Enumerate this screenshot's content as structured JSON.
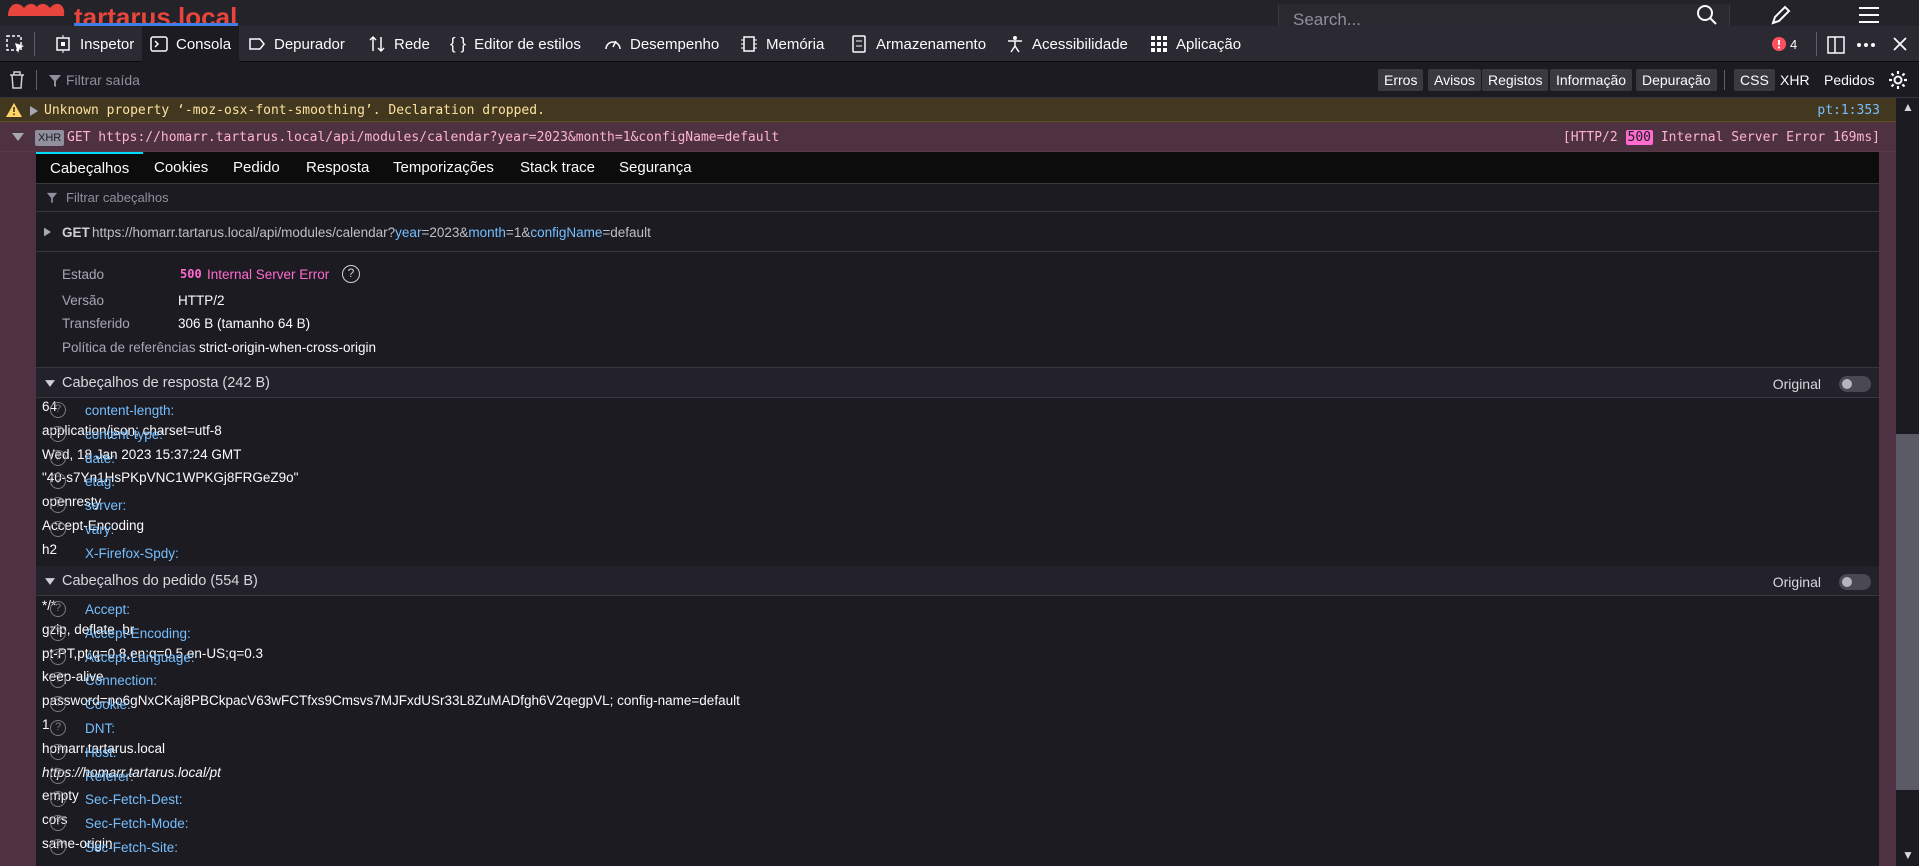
{
  "page": {
    "brand": "tartarus.local",
    "search_placeholder": "Search..."
  },
  "toolbar": {
    "tabs": [
      {
        "label": "Inspetor"
      },
      {
        "label": "Consola"
      },
      {
        "label": "Depurador"
      },
      {
        "label": "Rede"
      },
      {
        "label": "Editor de estilos"
      },
      {
        "label": "Desempenho"
      },
      {
        "label": "Memória"
      },
      {
        "label": "Armazenamento"
      },
      {
        "label": "Acessibilidade"
      },
      {
        "label": "Aplicação"
      }
    ],
    "error_count": "4"
  },
  "filterbar": {
    "placeholder": "Filtrar saída",
    "levels": [
      "Erros",
      "Avisos",
      "Registos",
      "Informação",
      "Depuração"
    ],
    "extras": [
      "CSS",
      "XHR",
      "Pedidos"
    ]
  },
  "warning": {
    "message": "Unknown property ‘-moz-osx-font-smoothing’.  Declaration dropped.",
    "location": "pt:1:353"
  },
  "request": {
    "badge": "XHR",
    "line": "GET https://homarr.tartarus.local/api/modules/calendar?year=2023&month=1&configName=default",
    "status_prefix": "[HTTP/2 ",
    "status_code": "500",
    "status_suffix": " Internal Server Error 169ms]"
  },
  "details": {
    "tabs": [
      "Cabeçalhos",
      "Cookies",
      "Pedido",
      "Resposta",
      "Temporizações",
      "Stack trace",
      "Segurança"
    ],
    "filter_placeholder": "Filtrar cabeçalhos",
    "method": "GET",
    "url_base": "https://homarr.tartarus.local/api/modules/calendar",
    "url_params": [
      {
        "key": "year",
        "value": "2023"
      },
      {
        "key": "month",
        "value": "1"
      },
      {
        "key": "configName",
        "value": "default"
      }
    ],
    "summary": {
      "estado_label": "Estado",
      "estado_code": "500",
      "estado_text": "Internal Server Error",
      "versao_label": "Versão",
      "versao": "HTTP/2",
      "transferido_label": "Transferido",
      "transferido": "306 B (tamanho 64 B)",
      "politica_label": "Política de referências",
      "politica": "strict-origin-when-cross-origin"
    },
    "response_headers_title": "Cabeçalhos de resposta (242 B)",
    "request_headers_title": "Cabeçalhos do pedido (554 B)",
    "original_label": "Original",
    "response_headers": [
      {
        "name": "content-length:",
        "value": "64",
        "help": true
      },
      {
        "name": "content-type:",
        "value": "application/json; charset=utf-8",
        "help": true
      },
      {
        "name": "date:",
        "value": "Wed, 18 Jan 2023 15:37:24 GMT",
        "help": true
      },
      {
        "name": "etag:",
        "value": "\"40-s7Yn1HsPKpVNC1WPKGj8FRGeZ9o\"",
        "help": true
      },
      {
        "name": "server:",
        "value": "openresty",
        "help": true
      },
      {
        "name": "vary:",
        "value": "Accept-Encoding",
        "help": true
      },
      {
        "name": "X-Firefox-Spdy:",
        "value": "h2",
        "help": false
      }
    ],
    "request_headers": [
      {
        "name": "Accept:",
        "value": "*/*"
      },
      {
        "name": "Accept-Encoding:",
        "value": "gzip, deflate, br"
      },
      {
        "name": "Accept-Language:",
        "value": "pt-PT,pt;q=0.8,en;q=0.5,en-US;q=0.3"
      },
      {
        "name": "Connection:",
        "value": "keep-alive"
      },
      {
        "name": "Cookie:",
        "value": "password=no6gNxCKaj8PBCkpacV63wFCTfxs9Cmsvs7MJFxdUSr33L8ZuMADfgh6V2qegpVL; config-name=default"
      },
      {
        "name": "DNT:",
        "value": "1"
      },
      {
        "name": "Host:",
        "value": "homarr.tartarus.local"
      },
      {
        "name": "Referer:",
        "value": "https://homarr.tartarus.local/pt"
      },
      {
        "name": "Sec-Fetch-Dest:",
        "value": "empty"
      },
      {
        "name": "Sec-Fetch-Mode:",
        "value": "cors"
      },
      {
        "name": "Sec-Fetch-Site:",
        "value": "same-origin"
      }
    ]
  }
}
